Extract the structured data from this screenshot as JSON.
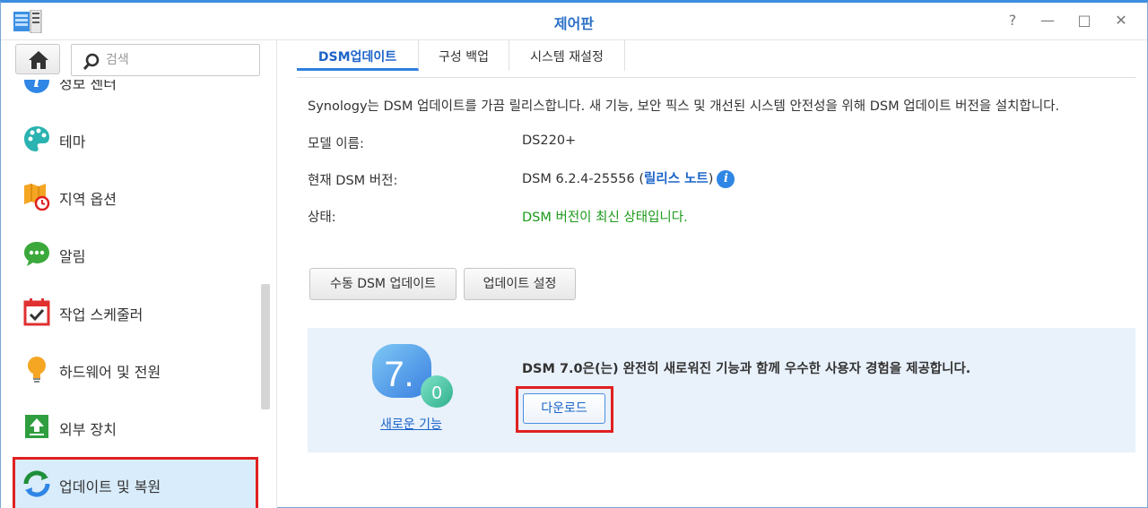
{
  "window": {
    "title": "제어판",
    "controls": [
      "?",
      "—",
      "□",
      "✕"
    ]
  },
  "sidebar": {
    "search_placeholder": "검색",
    "items": [
      {
        "label": "정보 센터",
        "icon": "info-icon"
      },
      {
        "label": "테마",
        "icon": "palette-icon"
      },
      {
        "label": "지역 옵션",
        "icon": "regional-clock-icon"
      },
      {
        "label": "알림",
        "icon": "notification-chat-icon"
      },
      {
        "label": "작업 스케줄러",
        "icon": "task-scheduler-icon"
      },
      {
        "label": "하드웨어 및 전원",
        "icon": "lightbulb-icon"
      },
      {
        "label": "외부 장치",
        "icon": "external-device-icon"
      },
      {
        "label": "업데이트 및 복원",
        "icon": "update-restore-icon",
        "active": true
      }
    ]
  },
  "tabs": [
    {
      "label": "DSM업데이트",
      "active": true
    },
    {
      "label": "구성 백업"
    },
    {
      "label": "시스템 재설정"
    }
  ],
  "main": {
    "intro": "Synology는 DSM 업데이트를 가끔 릴리스합니다. 새 기능, 보안 픽스 및 개선된 시스템 안전성을 위해 DSM 업데이트 버전을 설치합니다.",
    "model_label": "모델 이름:",
    "model_value": "DS220+",
    "version_label": "현재 DSM 버전:",
    "version_value": "DSM 6.2.4-25556 (",
    "release_notes": "릴리스 노트",
    "version_close": ")",
    "status_label": "상태:",
    "status_value": "DSM 버전이 최신 상태입니다.",
    "manual_update_button": "수동 DSM 업데이트",
    "update_settings_button": "업데이트 설정"
  },
  "promo": {
    "logo_major": "7.",
    "logo_minor": "0",
    "new_features_link": "새로운 기능",
    "text": "DSM 7.0은(는) 완전히 새로워진 기능과 함께 우수한 사용자 경험을 제공합니다.",
    "download_button": "다운로드"
  },
  "colors": {
    "accent": "#2f7fe0",
    "status_ok": "#1a9a1a",
    "highlight": "#e02020",
    "promo_bg": "#e9f1fb"
  }
}
